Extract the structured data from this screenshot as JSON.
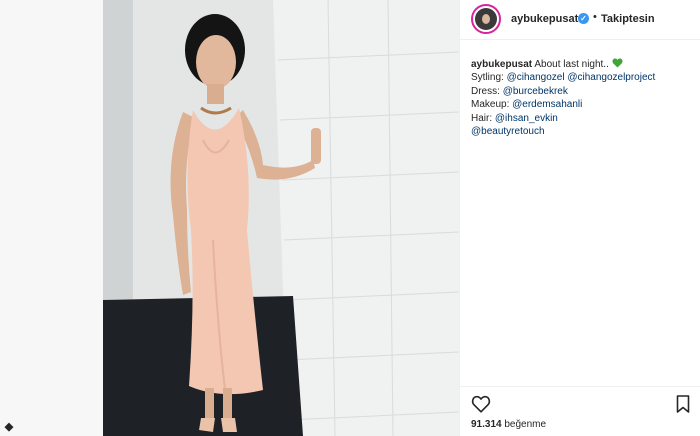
{
  "post": {
    "username": "aybukepusat",
    "verified_badge": "✓",
    "separator": "•",
    "follow_status": "Takiptesin"
  },
  "caption": {
    "author": "aybukepusat",
    "line1_text": "About last night..",
    "heart_icon": "green-heart-icon",
    "line2_label": "Sytling:",
    "line2_mention1": "@cihangozel",
    "line2_mention2": "@cihangozelproject",
    "line3_label": "Dress:",
    "line3_mention": "@burcebekrek",
    "line4_label": "Makeup:",
    "line4_mention": "@erdemsahanli",
    "line5_label": "Hair:",
    "line5_mention": "@ihsan_evkin",
    "line6_mention": "@beautyretouch"
  },
  "actions": {
    "like_icon": "heart-outline-icon",
    "save_icon": "bookmark-icon",
    "likes_number": "91.314",
    "likes_word": "beğenme"
  },
  "colors": {
    "mention": "#003569",
    "verified": "#3897f0",
    "dress": "#f3c7b2",
    "green_heart": "#3fa535"
  }
}
